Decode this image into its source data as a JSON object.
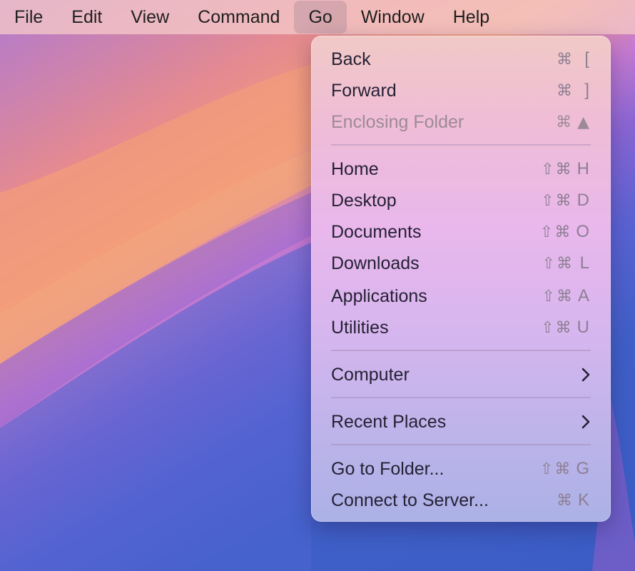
{
  "menubar": {
    "items": [
      "File",
      "Edit",
      "View",
      "Command",
      "Go",
      "Window",
      "Help"
    ]
  },
  "go_menu": {
    "back": {
      "label": "Back",
      "mod": "⌘",
      "key": "["
    },
    "forward": {
      "label": "Forward",
      "mod": "⌘",
      "key": "]"
    },
    "enclosing": {
      "label": "Enclosing Folder",
      "mod": "⌘",
      "key": "▲"
    },
    "home": {
      "label": "Home",
      "mod": "⇧⌘",
      "key": "H"
    },
    "desktop": {
      "label": "Desktop",
      "mod": "⇧⌘",
      "key": "D"
    },
    "documents": {
      "label": "Documents",
      "mod": "⇧⌘",
      "key": "O"
    },
    "downloads": {
      "label": "Downloads",
      "mod": "⇧⌘",
      "key": "L"
    },
    "applications": {
      "label": "Applications",
      "mod": "⇧⌘",
      "key": "A"
    },
    "utilities": {
      "label": "Utilities",
      "mod": "⇧⌘",
      "key": "U"
    },
    "computer": {
      "label": "Computer"
    },
    "recent": {
      "label": "Recent Places"
    },
    "goto": {
      "label": "Go to Folder...",
      "mod": "⇧⌘",
      "key": "G"
    },
    "connect": {
      "label": "Connect to Server...",
      "mod": "⌘",
      "key": "K"
    }
  }
}
